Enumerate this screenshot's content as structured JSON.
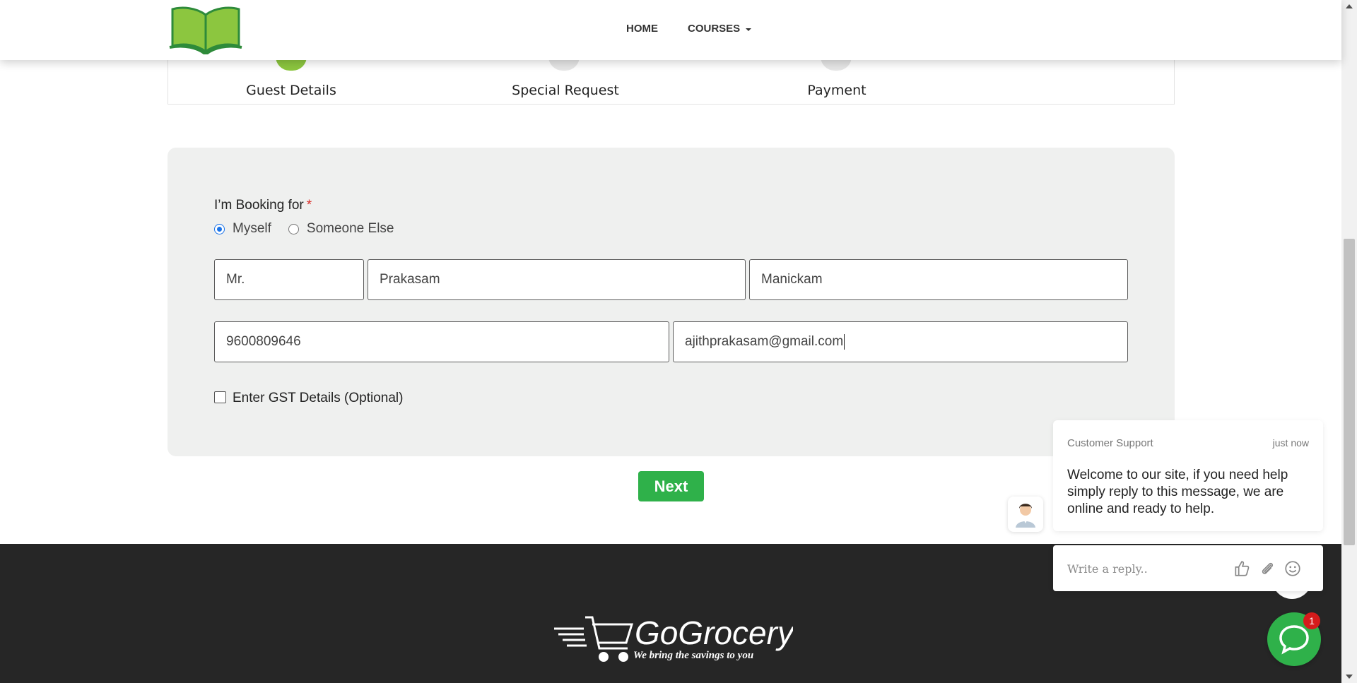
{
  "header": {
    "logo_icon": "open-book-icon",
    "nav": [
      {
        "label": "HOME"
      },
      {
        "label": "COURSES"
      }
    ]
  },
  "steps": [
    {
      "label": "Guest Details",
      "color": "#8cc63f"
    },
    {
      "label": "Special Request",
      "color": "#e6e6e6"
    },
    {
      "label": "Payment",
      "color": "#e6e6e6"
    }
  ],
  "form": {
    "booking_for_label": "I’m Booking for",
    "required_mark": "*",
    "radio_options": [
      {
        "label": "Myself",
        "selected": true
      },
      {
        "label": "Someone Else",
        "selected": false
      }
    ],
    "title_value": "Mr.",
    "first_name_value": "Prakasam",
    "last_name_value": "Manickam",
    "phone_value": "9600809646",
    "email_value": "ajithprakasam@gmail.com",
    "gst_label": "Enter GST Details (Optional)",
    "next_label": "Next"
  },
  "footer": {
    "brand": "GoGrocery",
    "tagline": "We bring the savings to you"
  },
  "chat": {
    "sender": "Customer Support",
    "time": "just now",
    "message": "Welcome to our site, if you need help simply reply to this message, we are online and ready to help.",
    "reply_placeholder": "Write a reply..",
    "badge_count": "1",
    "icons": [
      "thumbs-up-icon",
      "paperclip-icon",
      "emoji-icon"
    ]
  },
  "colors": {
    "accent_green": "#2fb14a",
    "panel_bg": "#eff0ef",
    "footer_bg": "#262626",
    "badge_red": "#d51b1b"
  }
}
